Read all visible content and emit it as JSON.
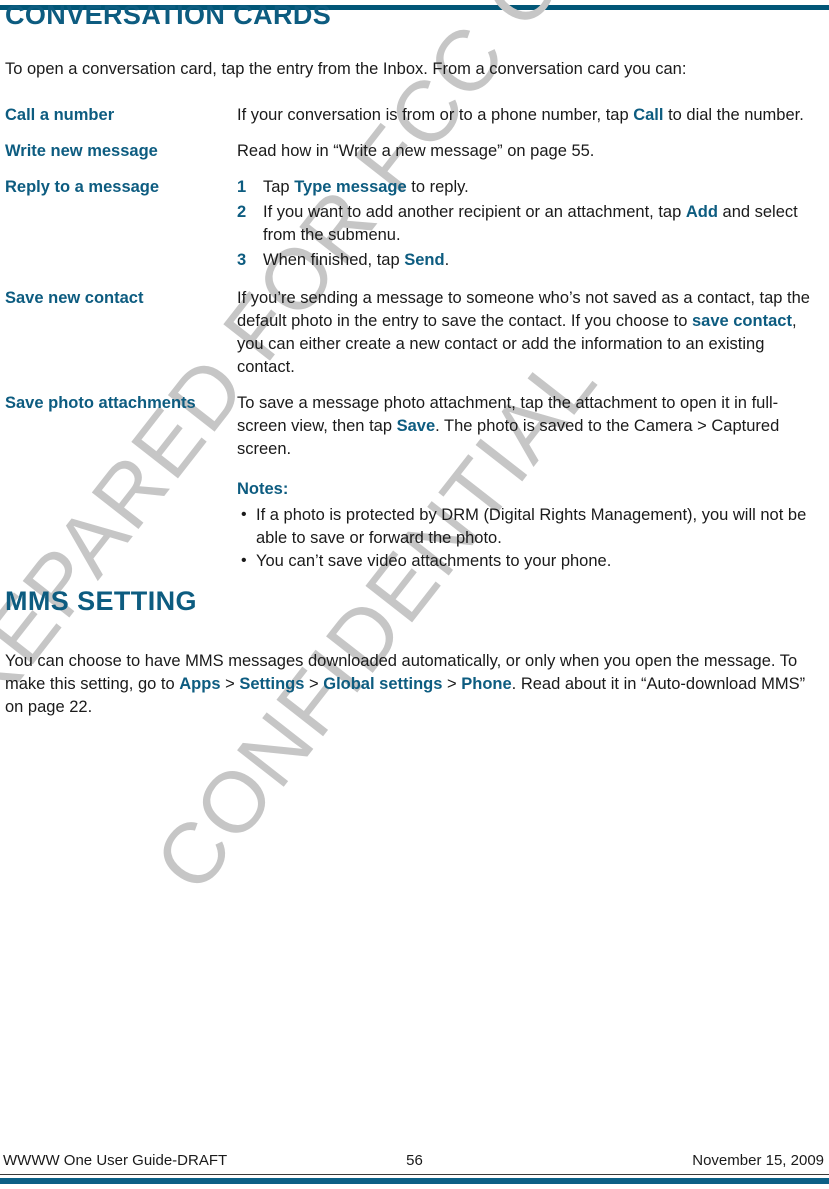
{
  "page": {
    "accent_color": "#0d5c80",
    "rule_color": "#015677",
    "watermark_color": "#c6c6c6"
  },
  "watermark": {
    "line1": "PREPARED FOR FCC CERTIFICATION",
    "line2": "CONFIDENTIAL"
  },
  "sections": {
    "conversation_cards": {
      "title": "CONVERSATION CARDS",
      "intro": "To open a conversation card, tap the entry from the Inbox. From a conversation card you can:",
      "entries": [
        {
          "term": "Call a number",
          "desc_parts": [
            "If your conversation is from or to a phone number, tap ",
            "Call",
            " to dial the number."
          ]
        },
        {
          "term": "Write new message",
          "desc": "Read how in “Write a new message” on page 55."
        },
        {
          "term": "Reply to a message",
          "steps": [
            {
              "num": "1",
              "pre": "Tap ",
              "bold": "Type message",
              "post": " to reply."
            },
            {
              "num": "2",
              "pre": "If you want to add another recipient or an attachment, tap ",
              "bold": "Add",
              "post": " and select from the submenu."
            },
            {
              "num": "3",
              "pre": "When finished, tap ",
              "bold": "Send",
              "post": "."
            }
          ]
        },
        {
          "term": "Save new contact",
          "desc_parts": [
            "If you’re sending a message to someone who’s not saved as a contact, tap the default photo in the entry to save the contact. If you choose to ",
            "save contact",
            ", you can either create a new contact or add the information to an existing contact."
          ]
        },
        {
          "term": "Save photo attachments",
          "desc_parts": [
            "To save a message photo attachment, tap the attachment to open it in full-screen view, then tap ",
            "Save",
            ". The photo is saved to the Camera > Captured screen."
          ],
          "notes_label": "Notes:",
          "notes": [
            "If a photo is protected by DRM (Digital Rights Management), you will not be able to save or forward the photo.",
            "You can’t save video attachments to your phone."
          ]
        }
      ]
    },
    "mms_setting": {
      "title": "MMS SETTING",
      "para_parts": {
        "p1": "You can choose to have MMS messages downloaded automatically, or only when you open the message. To make this setting, go to ",
        "b1": "Apps",
        "s1": " > ",
        "b2": "Settings",
        "s2": " > ",
        "b3": "Global settings",
        "s3": " > ",
        "b4": "Phone",
        "p2": ". Read about it in “Auto-download MMS” on page 22."
      }
    }
  },
  "footer": {
    "left": "WWWW One User Guide-DRAFT",
    "page_number": "56",
    "right": "November 15, 2009"
  }
}
